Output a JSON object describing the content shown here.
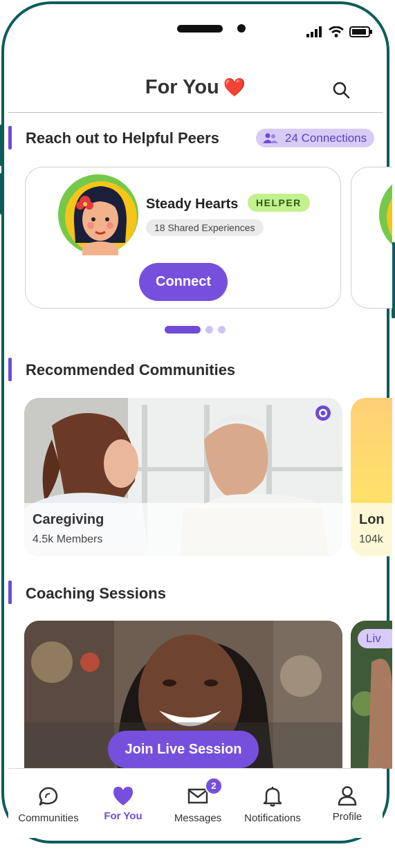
{
  "status_bar": {
    "icons": [
      "signal-icon",
      "wifi-icon",
      "battery-icon"
    ]
  },
  "header": {
    "title": "For You",
    "title_emoji": "❤️"
  },
  "peers": {
    "title": "Reach out to Helpful Peers",
    "connections_label": "24 Connections",
    "card": {
      "name": "Steady Hearts",
      "badge": "HELPER",
      "shared": "18 Shared Experiences",
      "connect_label": "Connect"
    }
  },
  "communities": {
    "title": "Recommended Communities",
    "items": [
      {
        "name": "Caregiving",
        "members": "4.5k Members"
      },
      {
        "name": "Lon",
        "members": "104k"
      }
    ]
  },
  "coaching": {
    "title": "Coaching Sessions",
    "join_label": "Join Live Session",
    "next_badge": "Liv"
  },
  "tabs": [
    {
      "label": "Communities",
      "icon": "chat-bubbles-icon"
    },
    {
      "label": "For You",
      "icon": "heart-icon",
      "active": true
    },
    {
      "label": "Messages",
      "icon": "envelope-icon",
      "badge": "2"
    },
    {
      "label": "Notifications",
      "icon": "bell-icon"
    },
    {
      "label": "Profile",
      "icon": "person-icon"
    }
  ],
  "colors": {
    "accent": "#7650dc",
    "frame": "#0d5c5a",
    "helper_badge": "#c5f08e",
    "heart": "#e11d2b"
  }
}
